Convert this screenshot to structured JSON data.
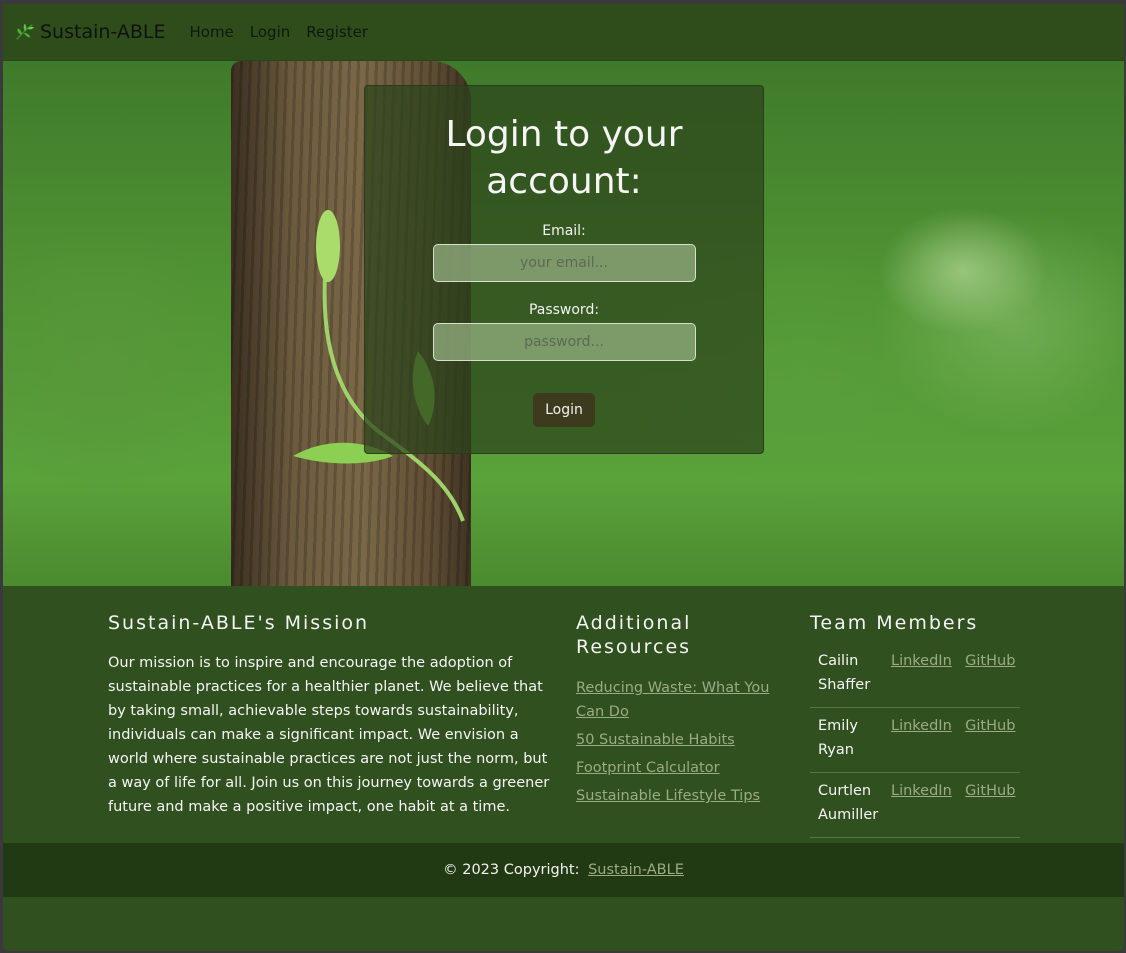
{
  "navbar": {
    "brand": "Sustain-ABLE",
    "links": [
      "Home",
      "Login",
      "Register"
    ]
  },
  "login": {
    "title": "Login to your account:",
    "email_label": "Email:",
    "email_placeholder": "your email...",
    "password_label": "Password:",
    "password_placeholder": "password...",
    "button": "Login"
  },
  "mission": {
    "heading": "Sustain-ABLE's Mission",
    "text": "Our mission is to inspire and encourage the adoption of sustainable practices for a healthier planet. We believe that by taking small, achievable steps towards sustainability, individuals can make a significant impact. We envision a world where sustainable practices are not just the norm, but a way of life for all. Join us on this journey towards a greener future and make a positive impact, one habit at a time."
  },
  "resources": {
    "heading": "Additional Resources",
    "links": [
      "Reducing Waste: What You Can Do",
      "50 Sustainable Habits",
      "Footprint Calculator",
      "Sustainable Lifestyle Tips"
    ]
  },
  "team": {
    "heading": "Team Members",
    "members": [
      {
        "name": "Cailin Shaffer",
        "linkedin": "LinkedIn",
        "github": "GitHub"
      },
      {
        "name": "Emily Ryan",
        "linkedin": "LinkedIn",
        "github": "GitHub"
      },
      {
        "name": "Curtlen Aumiller",
        "linkedin": "LinkedIn",
        "github": "GitHub"
      }
    ]
  },
  "copyright": {
    "text": "© 2023 Copyright:",
    "link": "Sustain-ABLE"
  },
  "icons": {
    "brand": "leaf-icon"
  },
  "colors": {
    "navbar": "#2e4d1b",
    "footer": "#30501f",
    "copyright_bar": "#223a13",
    "link": "#9aab85",
    "login_button": "#3e3a1e"
  }
}
